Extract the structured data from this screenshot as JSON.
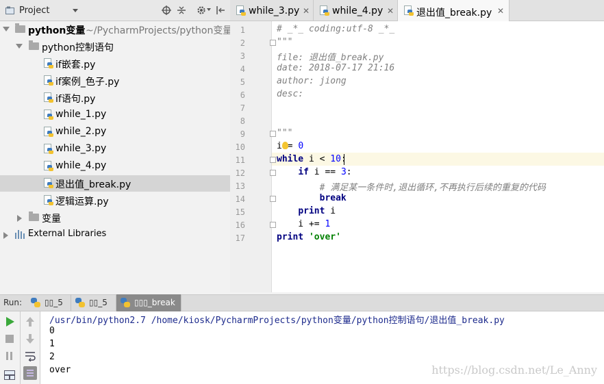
{
  "project_panel": {
    "title": "Project",
    "tree": [
      {
        "label": "python变量",
        "suffix": "~/PycharmProjects/python变量",
        "type": "folder",
        "level": 0,
        "expanded": true
      },
      {
        "label": "python控制语句",
        "type": "folder",
        "level": 1,
        "expanded": true
      },
      {
        "label": "if嵌套.py",
        "type": "file",
        "level": 2
      },
      {
        "label": "if案例_色子.py",
        "type": "file",
        "level": 2
      },
      {
        "label": "if语句.py",
        "type": "file",
        "level": 2
      },
      {
        "label": "while_1.py",
        "type": "file",
        "level": 2
      },
      {
        "label": "while_2.py",
        "type": "file",
        "level": 2
      },
      {
        "label": "while_3.py",
        "type": "file",
        "level": 2
      },
      {
        "label": "while_4.py",
        "type": "file",
        "level": 2
      },
      {
        "label": "退出值_break.py",
        "type": "file",
        "level": 2,
        "selected": true
      },
      {
        "label": "逻辑运算.py",
        "type": "file",
        "level": 2
      },
      {
        "label": "变量",
        "type": "folder",
        "level": 1,
        "expanded": false
      },
      {
        "label": "External Libraries",
        "type": "library",
        "level": 0,
        "expanded": false
      }
    ]
  },
  "editor_tabs": [
    {
      "label": "while_3.py",
      "active": false
    },
    {
      "label": "while_4.py",
      "active": false
    },
    {
      "label": "退出值_break.py",
      "active": true
    }
  ],
  "code": {
    "line_numbers": [
      "1",
      "2",
      "3",
      "4",
      "5",
      "6",
      "7",
      "8",
      "9",
      "10",
      "11",
      "12",
      "13",
      "14",
      "15",
      "16",
      "17"
    ],
    "lines": [
      "# _*_ coding:utf-8 _*_",
      "\"\"\"",
      "file: 退出值_break.py",
      "date: 2018-07-17 21:16",
      "author: jiong",
      "desc:",
      "",
      "",
      "\"\"\"",
      "i = 0",
      "while i < 10:",
      "    if i == 3:",
      "        # 满足某一条件时,退出循环,不再执行后续的重复的代码",
      "        break",
      "    print i",
      "    i += 1",
      "print 'over'"
    ]
  },
  "run": {
    "label": "Run:",
    "tabs": [
      {
        "label": "▯▯_5",
        "active": false
      },
      {
        "label": "▯▯_5",
        "active": false
      },
      {
        "label": "▯▯▯_break",
        "active": true
      }
    ],
    "output": [
      "/usr/bin/python2.7 /home/kiosk/PycharmProjects/python变量/python控制语句/退出值_break.py",
      "0",
      "1",
      "2",
      "over"
    ]
  },
  "watermark": "https://blog.csdn.net/Le_Anny",
  "colors": {
    "keyword": "#000080",
    "number": "#0000ff",
    "string": "#008000",
    "comment": "#808080",
    "selection": "#d5d5d5",
    "current_line": "#fcf8e4"
  }
}
